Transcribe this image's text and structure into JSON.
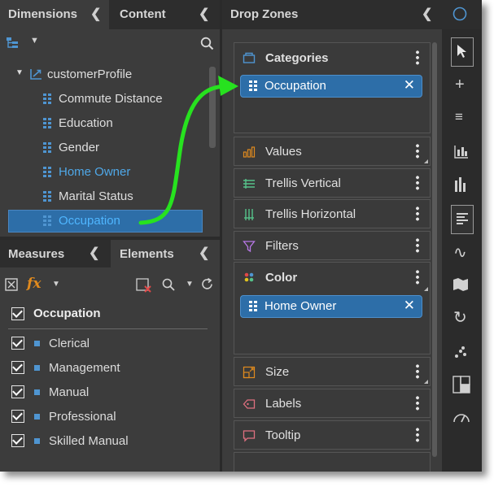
{
  "left_panel": {
    "tabs": [
      {
        "label": "Dimensions"
      },
      {
        "label": "Content"
      }
    ],
    "tree": {
      "root": "customerProfile",
      "items": [
        {
          "label": "Commute Distance",
          "highlighted": false,
          "selected": false
        },
        {
          "label": "Education",
          "highlighted": false,
          "selected": false
        },
        {
          "label": "Gender",
          "highlighted": false,
          "selected": false
        },
        {
          "label": "Home Owner",
          "highlighted": true,
          "selected": false
        },
        {
          "label": "Marital Status",
          "highlighted": false,
          "selected": false
        },
        {
          "label": "Occupation",
          "highlighted": true,
          "selected": true
        }
      ]
    }
  },
  "bottom_panel": {
    "tabs": [
      {
        "label": "Measures"
      },
      {
        "label": "Elements"
      }
    ],
    "group": {
      "label": "Occupation",
      "checked": true
    },
    "items": [
      {
        "label": "Clerical",
        "checked": true
      },
      {
        "label": "Management",
        "checked": true
      },
      {
        "label": "Manual",
        "checked": true
      },
      {
        "label": "Professional",
        "checked": true
      },
      {
        "label": "Skilled Manual",
        "checked": true
      }
    ]
  },
  "drop_zones": {
    "title": "Drop Zones",
    "zones": {
      "categories": {
        "label": "Categories",
        "pill": "Occupation"
      },
      "values": {
        "label": "Values"
      },
      "trellis_vertical": {
        "label": "Trellis Vertical"
      },
      "trellis_horizontal": {
        "label": "Trellis Horizontal"
      },
      "filters": {
        "label": "Filters"
      },
      "color": {
        "label": "Color",
        "pill": "Home Owner"
      },
      "size": {
        "label": "Size"
      },
      "labels": {
        "label": "Labels"
      },
      "tooltip": {
        "label": "Tooltip"
      }
    }
  },
  "colors": {
    "panel_bg": "#3c3c3c",
    "header_bg": "#2d2d2d",
    "accent_blue": "#4f95d1",
    "pill_bg": "#2d6ea8",
    "selection_bg": "#2d6ea8",
    "arrow": "#27e21f",
    "fx_icon": "#e08a1e",
    "clear_filter_icon": "#e04848"
  },
  "icons": [
    "hierarchy-icon",
    "chevron-down-icon",
    "search-icon",
    "chevron-left-icon",
    "fx-icon",
    "clear-filter-icon",
    "refresh-icon",
    "kebab-icon",
    "close-icon"
  ]
}
